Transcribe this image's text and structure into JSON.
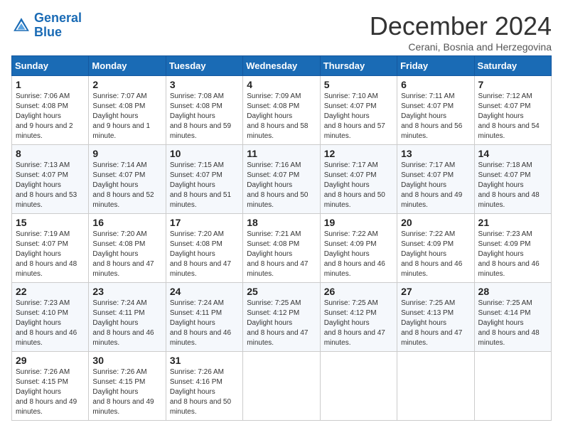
{
  "header": {
    "logo_line1": "General",
    "logo_line2": "Blue",
    "month": "December 2024",
    "location": "Cerani, Bosnia and Herzegovina"
  },
  "days_of_week": [
    "Sunday",
    "Monday",
    "Tuesday",
    "Wednesday",
    "Thursday",
    "Friday",
    "Saturday"
  ],
  "weeks": [
    [
      {
        "day": 1,
        "sunrise": "7:06 AM",
        "sunset": "4:08 PM",
        "daylight": "9 hours and 2 minutes."
      },
      {
        "day": 2,
        "sunrise": "7:07 AM",
        "sunset": "4:08 PM",
        "daylight": "9 hours and 1 minute."
      },
      {
        "day": 3,
        "sunrise": "7:08 AM",
        "sunset": "4:08 PM",
        "daylight": "8 hours and 59 minutes."
      },
      {
        "day": 4,
        "sunrise": "7:09 AM",
        "sunset": "4:08 PM",
        "daylight": "8 hours and 58 minutes."
      },
      {
        "day": 5,
        "sunrise": "7:10 AM",
        "sunset": "4:07 PM",
        "daylight": "8 hours and 57 minutes."
      },
      {
        "day": 6,
        "sunrise": "7:11 AM",
        "sunset": "4:07 PM",
        "daylight": "8 hours and 56 minutes."
      },
      {
        "day": 7,
        "sunrise": "7:12 AM",
        "sunset": "4:07 PM",
        "daylight": "8 hours and 54 minutes."
      }
    ],
    [
      {
        "day": 8,
        "sunrise": "7:13 AM",
        "sunset": "4:07 PM",
        "daylight": "8 hours and 53 minutes."
      },
      {
        "day": 9,
        "sunrise": "7:14 AM",
        "sunset": "4:07 PM",
        "daylight": "8 hours and 52 minutes."
      },
      {
        "day": 10,
        "sunrise": "7:15 AM",
        "sunset": "4:07 PM",
        "daylight": "8 hours and 51 minutes."
      },
      {
        "day": 11,
        "sunrise": "7:16 AM",
        "sunset": "4:07 PM",
        "daylight": "8 hours and 50 minutes."
      },
      {
        "day": 12,
        "sunrise": "7:17 AM",
        "sunset": "4:07 PM",
        "daylight": "8 hours and 50 minutes."
      },
      {
        "day": 13,
        "sunrise": "7:17 AM",
        "sunset": "4:07 PM",
        "daylight": "8 hours and 49 minutes."
      },
      {
        "day": 14,
        "sunrise": "7:18 AM",
        "sunset": "4:07 PM",
        "daylight": "8 hours and 48 minutes."
      }
    ],
    [
      {
        "day": 15,
        "sunrise": "7:19 AM",
        "sunset": "4:07 PM",
        "daylight": "8 hours and 48 minutes."
      },
      {
        "day": 16,
        "sunrise": "7:20 AM",
        "sunset": "4:08 PM",
        "daylight": "8 hours and 47 minutes."
      },
      {
        "day": 17,
        "sunrise": "7:20 AM",
        "sunset": "4:08 PM",
        "daylight": "8 hours and 47 minutes."
      },
      {
        "day": 18,
        "sunrise": "7:21 AM",
        "sunset": "4:08 PM",
        "daylight": "8 hours and 47 minutes."
      },
      {
        "day": 19,
        "sunrise": "7:22 AM",
        "sunset": "4:09 PM",
        "daylight": "8 hours and 46 minutes."
      },
      {
        "day": 20,
        "sunrise": "7:22 AM",
        "sunset": "4:09 PM",
        "daylight": "8 hours and 46 minutes."
      },
      {
        "day": 21,
        "sunrise": "7:23 AM",
        "sunset": "4:09 PM",
        "daylight": "8 hours and 46 minutes."
      }
    ],
    [
      {
        "day": 22,
        "sunrise": "7:23 AM",
        "sunset": "4:10 PM",
        "daylight": "8 hours and 46 minutes."
      },
      {
        "day": 23,
        "sunrise": "7:24 AM",
        "sunset": "4:11 PM",
        "daylight": "8 hours and 46 minutes."
      },
      {
        "day": 24,
        "sunrise": "7:24 AM",
        "sunset": "4:11 PM",
        "daylight": "8 hours and 46 minutes."
      },
      {
        "day": 25,
        "sunrise": "7:25 AM",
        "sunset": "4:12 PM",
        "daylight": "8 hours and 47 minutes."
      },
      {
        "day": 26,
        "sunrise": "7:25 AM",
        "sunset": "4:12 PM",
        "daylight": "8 hours and 47 minutes."
      },
      {
        "day": 27,
        "sunrise": "7:25 AM",
        "sunset": "4:13 PM",
        "daylight": "8 hours and 47 minutes."
      },
      {
        "day": 28,
        "sunrise": "7:25 AM",
        "sunset": "4:14 PM",
        "daylight": "8 hours and 48 minutes."
      }
    ],
    [
      {
        "day": 29,
        "sunrise": "7:26 AM",
        "sunset": "4:15 PM",
        "daylight": "8 hours and 49 minutes."
      },
      {
        "day": 30,
        "sunrise": "7:26 AM",
        "sunset": "4:15 PM",
        "daylight": "8 hours and 49 minutes."
      },
      {
        "day": 31,
        "sunrise": "7:26 AM",
        "sunset": "4:16 PM",
        "daylight": "8 hours and 50 minutes."
      },
      null,
      null,
      null,
      null
    ]
  ]
}
